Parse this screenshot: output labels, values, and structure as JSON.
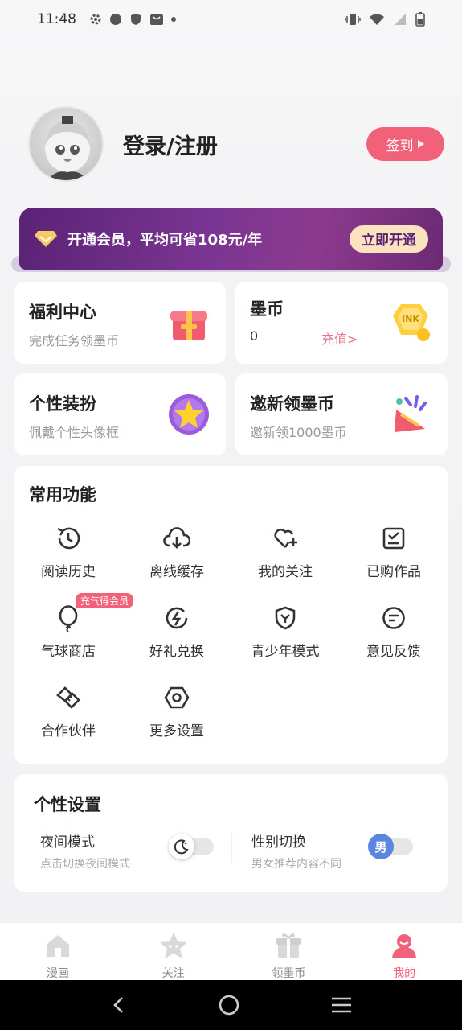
{
  "status": {
    "time": "11:48"
  },
  "profile": {
    "login_label": "登录/注册",
    "signin_label": "签到"
  },
  "vip": {
    "text": "开通会员，平均可省108元/年",
    "button": "立即开通"
  },
  "cards": {
    "welfare": {
      "title": "福利中心",
      "sub": "完成任务领墨币"
    },
    "coin": {
      "title": "墨币",
      "amount": "0",
      "recharge": "充值>"
    },
    "dress": {
      "title": "个性装扮",
      "sub": "佩戴个性头像框"
    },
    "invite": {
      "title": "邀新领墨币",
      "sub": "邀新领1000墨币"
    }
  },
  "functions": {
    "title": "常用功能",
    "items": [
      {
        "label": "阅读历史",
        "icon": "history-icon"
      },
      {
        "label": "离线缓存",
        "icon": "cloud-download-icon"
      },
      {
        "label": "我的关注",
        "icon": "heart-plus-icon"
      },
      {
        "label": "已购作品",
        "icon": "purchased-icon"
      },
      {
        "label": "气球商店",
        "icon": "balloon-icon",
        "badge": "充气得会员"
      },
      {
        "label": "好礼兑换",
        "icon": "lightning-icon"
      },
      {
        "label": "青少年模式",
        "icon": "shield-icon"
      },
      {
        "label": "意见反馈",
        "icon": "feedback-icon"
      },
      {
        "label": "合作伙伴",
        "icon": "handshake-icon"
      },
      {
        "label": "更多设置",
        "icon": "settings-icon"
      }
    ]
  },
  "personal": {
    "title": "个性设置",
    "night": {
      "title": "夜间模式",
      "sub": "点击切换夜间模式"
    },
    "gender": {
      "title": "性别切换",
      "sub": "男女推荐内容不同",
      "value": "男"
    }
  },
  "tabs": [
    {
      "label": "漫画",
      "icon": "home-icon"
    },
    {
      "label": "关注",
      "icon": "star-face-icon"
    },
    {
      "label": "领墨币",
      "icon": "gift-icon"
    },
    {
      "label": "我的",
      "icon": "profile-icon",
      "active": true
    }
  ],
  "colors": {
    "accent": "#f2617a",
    "vip_bg": "#6d2a80",
    "vip_button": "#fbe3bf"
  }
}
